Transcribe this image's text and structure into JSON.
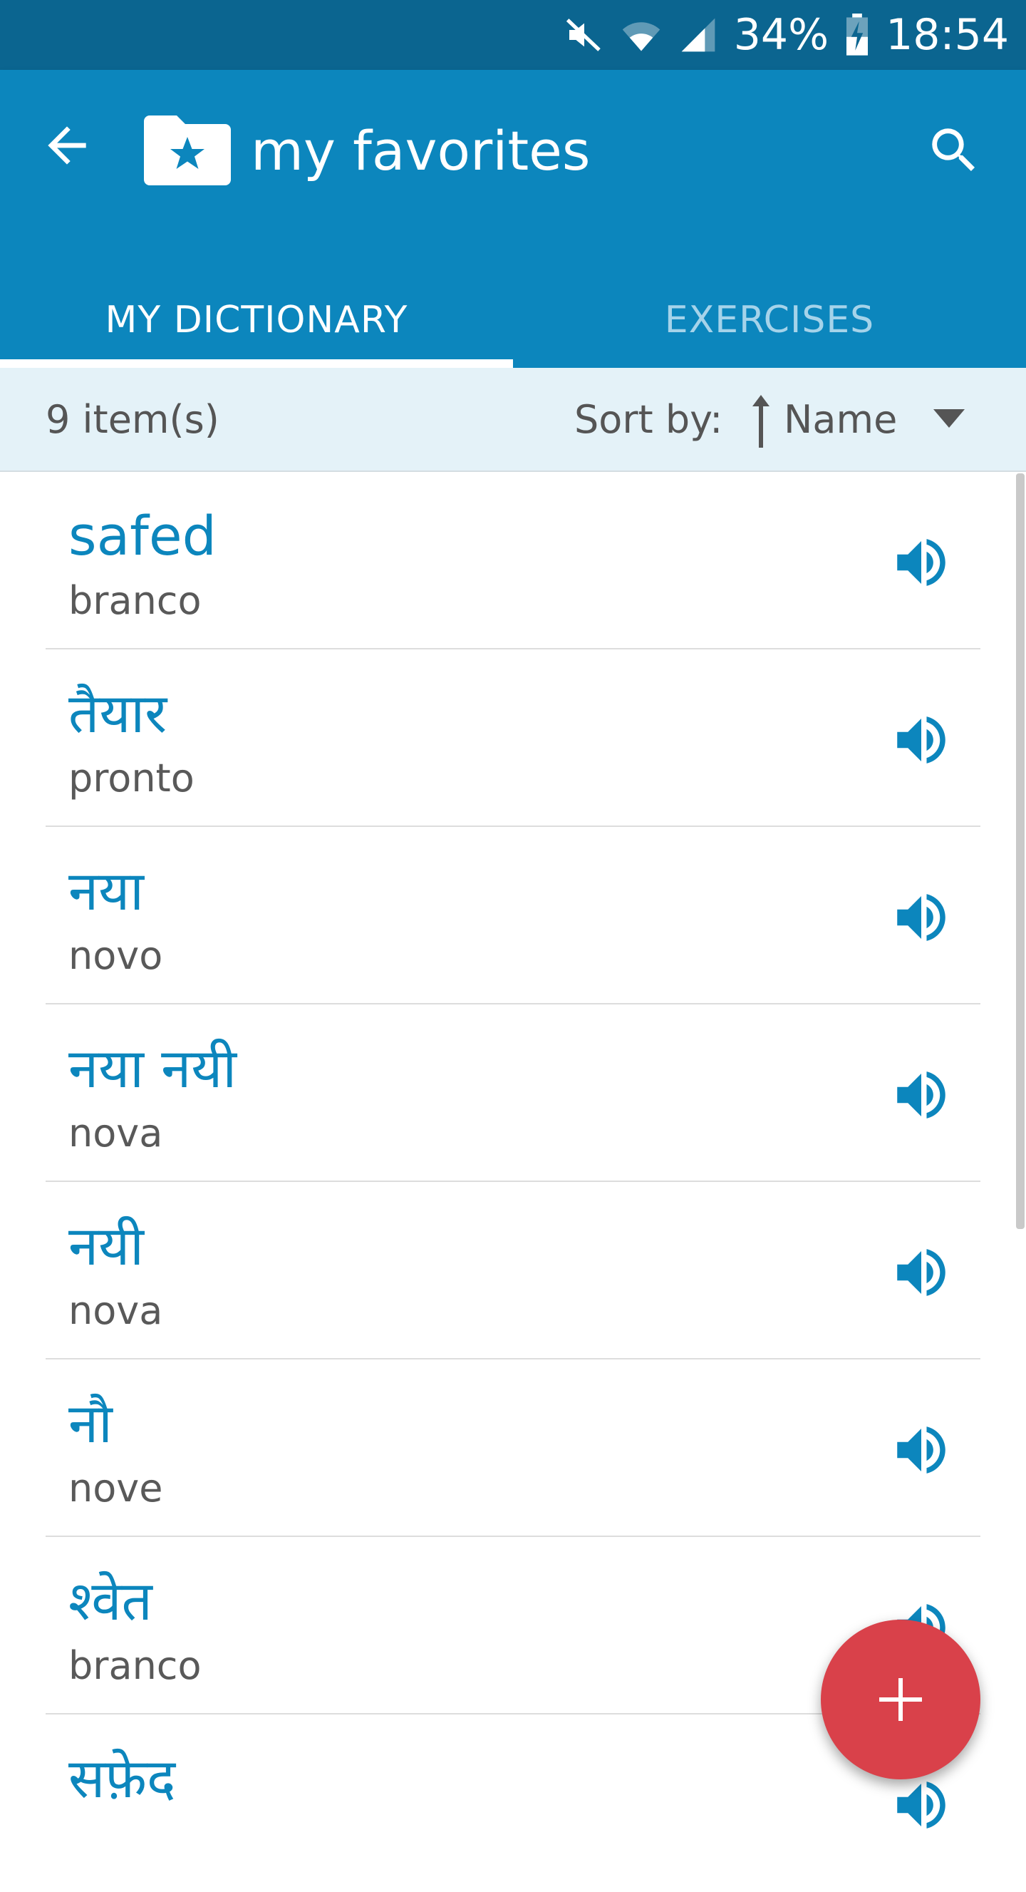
{
  "status_bar": {
    "battery": "34%",
    "time": "18:54",
    "icons": [
      "mute-icon",
      "wifi-icon",
      "signal-icon",
      "battery-charging-icon"
    ]
  },
  "app_bar": {
    "title": "my favorites",
    "back_icon": "arrow-left-icon",
    "folder_icon": "folder-star-icon",
    "search_icon": "search-icon",
    "color": "#0c86bd"
  },
  "tabs": [
    {
      "label": "MY DICTIONARY",
      "active": true
    },
    {
      "label": "EXERCISES",
      "active": false
    }
  ],
  "sort_bar": {
    "count": "9 item(s)",
    "label": "Sort by:",
    "value": "Name",
    "direction_icon": "sort-ascending-icon",
    "dropdown_icon": "dropdown-triangle-icon"
  },
  "items": [
    {
      "word": "safed",
      "translation": "branco"
    },
    {
      "word": "तैयार",
      "translation": "pronto"
    },
    {
      "word": "नया",
      "translation": "novo"
    },
    {
      "word": "नया नयी",
      "translation": "nova"
    },
    {
      "word": "नयी",
      "translation": "nova"
    },
    {
      "word": "नौ",
      "translation": "nove"
    },
    {
      "word": "श्वेत",
      "translation": "branco"
    },
    {
      "word": "सफ़ेद",
      "translation": ""
    }
  ],
  "fab": {
    "icon": "plus-icon",
    "color": "#d9414a"
  }
}
